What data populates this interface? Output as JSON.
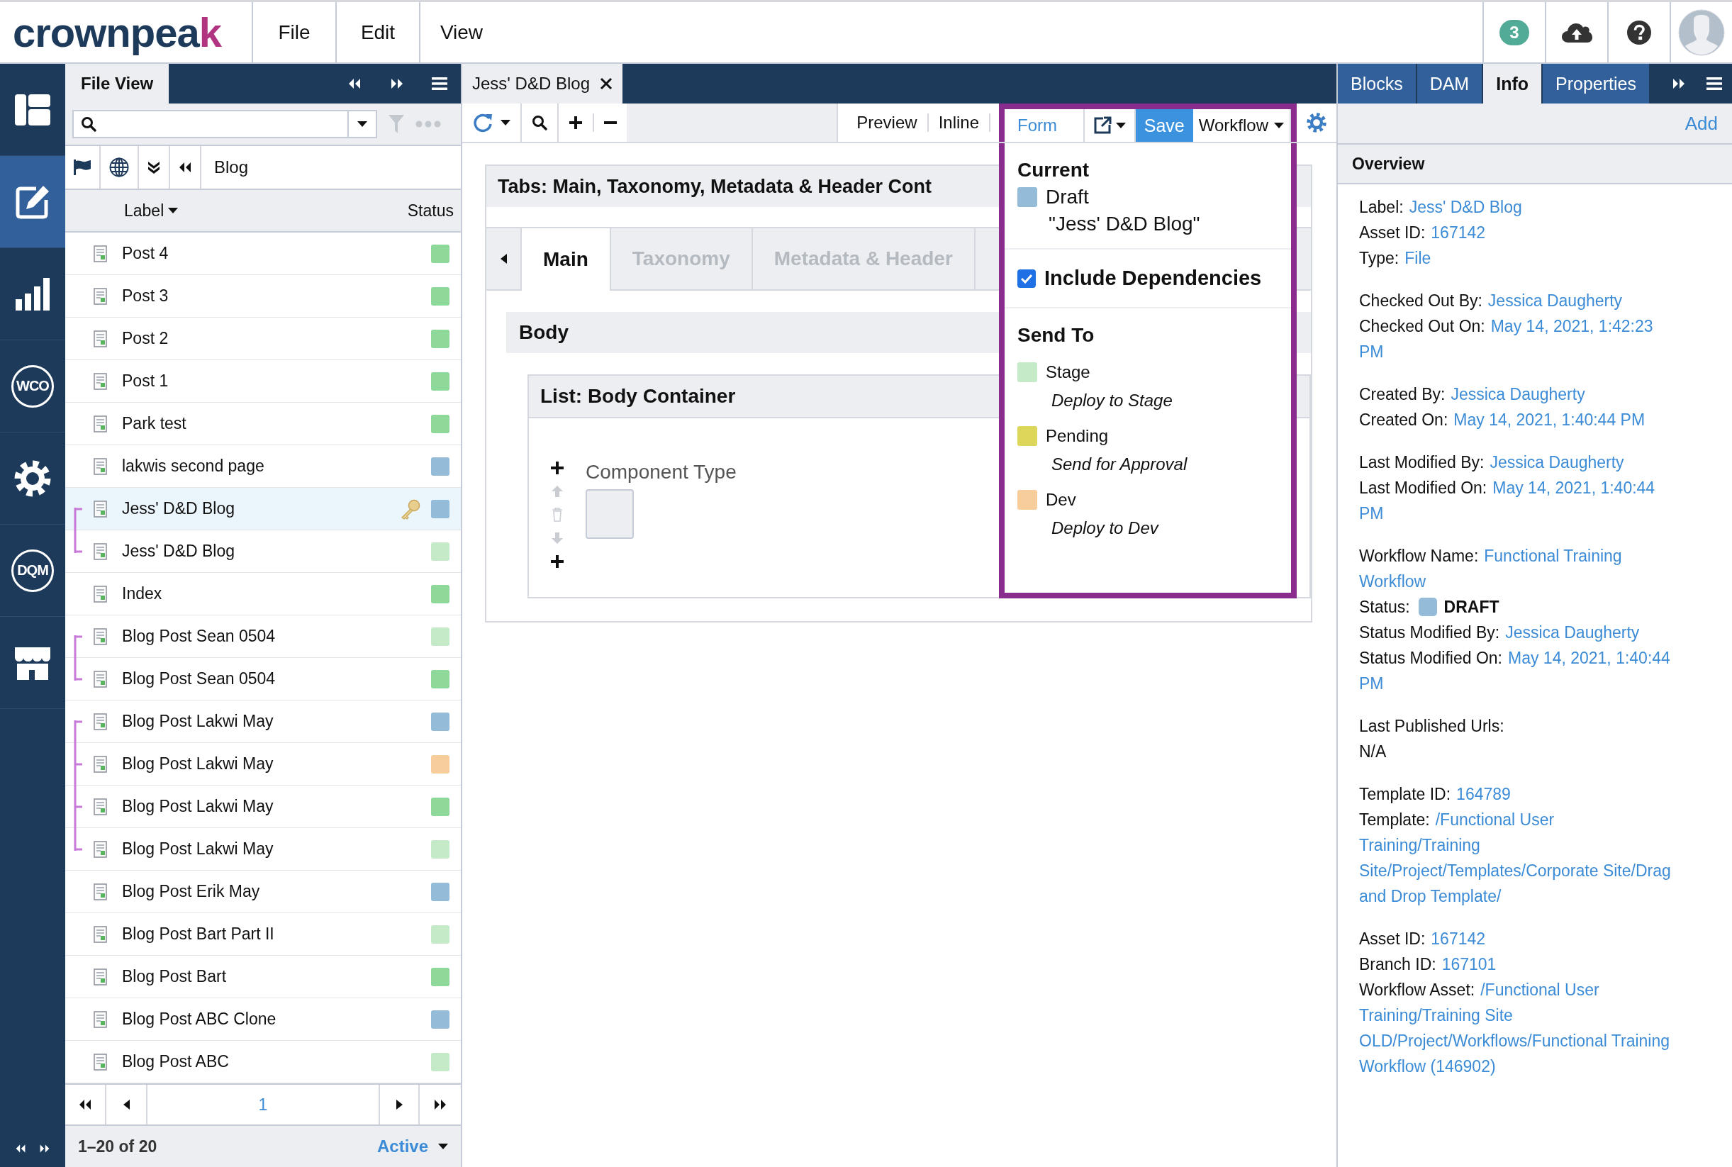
{
  "app_bar": {
    "logo": {
      "main": "crownpea",
      "accent": "k"
    },
    "menus": [
      "File",
      "Edit",
      "View"
    ],
    "notification_count": "3"
  },
  "rail": {
    "items": [
      {
        "kind": "layout",
        "selected": false
      },
      {
        "kind": "edit",
        "selected": true
      },
      {
        "kind": "chart",
        "selected": false
      },
      {
        "kind": "badge",
        "label": "WCO",
        "selected": false
      },
      {
        "kind": "gear",
        "selected": false
      },
      {
        "kind": "badge",
        "label": "DQM",
        "selected": false
      },
      {
        "kind": "store",
        "selected": false
      }
    ]
  },
  "file_panel": {
    "tab": "File View",
    "breadcrumb": "Blog",
    "columns": [
      "Label",
      "Status"
    ],
    "rows": [
      {
        "label": "Post 4",
        "color": "#8ed89a",
        "selected": false,
        "checked_out": false
      },
      {
        "label": "Post 3",
        "color": "#8ed89a",
        "selected": false,
        "checked_out": false
      },
      {
        "label": "Post 2",
        "color": "#8ed89a",
        "selected": false,
        "checked_out": false
      },
      {
        "label": "Post 1",
        "color": "#8ed89a",
        "selected": false,
        "checked_out": false
      },
      {
        "label": "Park test",
        "color": "#8ed89a",
        "selected": false,
        "checked_out": false
      },
      {
        "label": "lakwis second page",
        "color": "#94bcd9",
        "selected": false,
        "checked_out": false
      },
      {
        "label": "Jess' D&D Blog",
        "color": "#94bcd9",
        "selected": true,
        "checked_out": true,
        "linked_above": false,
        "linked_below": true
      },
      {
        "label": "Jess' D&D Blog",
        "color": "#c4eac8",
        "selected": false,
        "checked_out": false,
        "linked_above": true,
        "linked_below": false
      },
      {
        "label": "Index",
        "color": "#8ed89a",
        "selected": false,
        "checked_out": false
      },
      {
        "label": "Blog Post Sean 0504",
        "color": "#c4eac8",
        "selected": false,
        "checked_out": false,
        "linked_above": false,
        "linked_below": true
      },
      {
        "label": "Blog Post Sean 0504",
        "color": "#8ed89a",
        "selected": false,
        "checked_out": false,
        "linked_above": true,
        "linked_below": false
      },
      {
        "label": "Blog Post Lakwi May",
        "color": "#94bcd9",
        "selected": false,
        "checked_out": false,
        "linked_above": false,
        "linked_below": true
      },
      {
        "label": "Blog Post Lakwi May",
        "color": "#f7cd9b",
        "selected": false,
        "checked_out": false,
        "linked_above": true,
        "linked_below": true
      },
      {
        "label": "Blog Post Lakwi May",
        "color": "#8ed89a",
        "selected": false,
        "checked_out": false,
        "linked_above": true,
        "linked_below": true
      },
      {
        "label": "Blog Post Lakwi May",
        "color": "#c4eac8",
        "selected": false,
        "checked_out": false,
        "linked_above": true,
        "linked_below": false
      },
      {
        "label": "Blog Post Erik May",
        "color": "#94bcd9",
        "selected": false,
        "checked_out": false
      },
      {
        "label": "Blog Post Bart Part II",
        "color": "#c4eac8",
        "selected": false,
        "checked_out": false
      },
      {
        "label": "Blog Post Bart",
        "color": "#8ed89a",
        "selected": false,
        "checked_out": false
      },
      {
        "label": "Blog Post ABC Clone",
        "color": "#94bcd9",
        "selected": false,
        "checked_out": false
      },
      {
        "label": "Blog Post ABC",
        "color": "#c4eac8",
        "selected": false,
        "checked_out": false
      }
    ],
    "pager": {
      "page": "1"
    },
    "footer": {
      "range": "1–20 of 20",
      "filter": "Active"
    }
  },
  "editor": {
    "tab": "Jess' D&D Blog",
    "views": [
      {
        "label": "Preview",
        "selected": false
      },
      {
        "label": "Inline",
        "selected": false
      },
      {
        "label": "Form",
        "selected": true
      }
    ],
    "save": "Save",
    "workflow": "Workflow",
    "form": {
      "title": "Tabs: Main, Taxonomy, Metadata & Header Cont",
      "tabs": [
        {
          "label": "Main",
          "selected": true
        },
        {
          "label": "Taxonomy",
          "selected": false
        },
        {
          "label": "Metadata & Header",
          "selected": false
        }
      ],
      "section": "Body",
      "list_title": "List: Body Container",
      "field_label": "Component Type"
    }
  },
  "workflow_menu": {
    "current": {
      "heading": "Current",
      "status": "Draft",
      "color": "#94bcd9",
      "asset": "\"Jess' D&D Blog\""
    },
    "include_dependencies": {
      "label": "Include Dependencies",
      "checked": true
    },
    "send_to": {
      "heading": "Send To",
      "options": [
        {
          "name": "Stage",
          "color": "#c4eac8",
          "action": "Deploy to Stage"
        },
        {
          "name": "Pending",
          "color": "#dcd75a",
          "action": "Send for Approval"
        },
        {
          "name": "Dev",
          "color": "#f7cd9b",
          "action": "Deploy to Dev"
        }
      ]
    }
  },
  "info_panel": {
    "tabs": [
      {
        "label": "Blocks",
        "selected": false
      },
      {
        "label": "DAM",
        "selected": false
      },
      {
        "label": "Info",
        "selected": true
      },
      {
        "label": "Properties",
        "selected": false
      }
    ],
    "add": "Add",
    "heading": "Overview",
    "groups": [
      [
        {
          "label": "Label:",
          "value": "Jess' D&D Blog",
          "kind": "link"
        },
        {
          "label": "Asset ID:",
          "value": "167142",
          "kind": "link"
        },
        {
          "label": "Type:",
          "value": "File",
          "kind": "link"
        }
      ],
      [
        {
          "label": "Checked Out By:",
          "value": "Jessica Daugherty",
          "kind": "link"
        },
        {
          "label": "Checked Out On:",
          "value": "May 14, 2021, 1:42:23 PM",
          "kind": "link"
        }
      ],
      [
        {
          "label": "Created By:",
          "value": "Jessica Daugherty",
          "kind": "link"
        },
        {
          "label": "Created On:",
          "value": "May 14, 2021, 1:40:44 PM",
          "kind": "link"
        }
      ],
      [
        {
          "label": "Last Modified By:",
          "value": "Jessica Daugherty",
          "kind": "link"
        },
        {
          "label": "Last Modified On:",
          "value": "May 14, 2021, 1:40:44 PM",
          "kind": "link"
        }
      ],
      [
        {
          "label": "Workflow Name:",
          "value": "Functional Training Workflow",
          "kind": "link"
        },
        {
          "label": "Status:",
          "value": "DRAFT",
          "kind": "status",
          "color": "#94bcd9"
        },
        {
          "label": "Status Modified By:",
          "value": "Jessica Daugherty",
          "kind": "link"
        },
        {
          "label": "Status Modified On:",
          "value": "May 14, 2021, 1:40:44 PM",
          "kind": "link"
        }
      ],
      [
        {
          "label": "Last Published Urls:",
          "value": "N/A",
          "kind": "block"
        }
      ],
      [
        {
          "label": "Template ID:",
          "value": "164789",
          "kind": "link"
        },
        {
          "label": "Template:",
          "value": "/Functional User Training/Training Site/Project/Templates/Corporate Site/Drag and Drop Template/",
          "kind": "link"
        }
      ],
      [
        {
          "label": "Asset ID:",
          "value": "167142",
          "kind": "link"
        },
        {
          "label": "Branch ID:",
          "value": "167101",
          "kind": "link"
        },
        {
          "label": "Workflow Asset:",
          "value": "/Functional User Training/Training Site OLD/Project/Workflows/Functional Training Workflow (146902)",
          "kind": "link"
        }
      ]
    ]
  }
}
